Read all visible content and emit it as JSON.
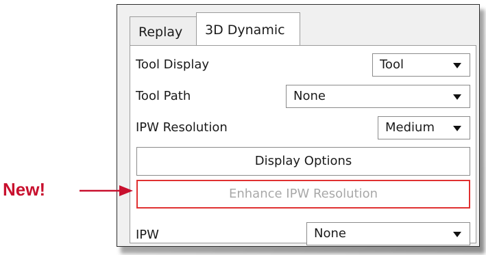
{
  "tabs": [
    {
      "label": "Replay",
      "active": false
    },
    {
      "label": "3D Dynamic",
      "active": true
    }
  ],
  "rows": {
    "tool_display": {
      "label": "Tool Display",
      "value": "Tool"
    },
    "tool_path": {
      "label": "Tool Path",
      "value": "None"
    },
    "ipw_resolution": {
      "label": "IPW Resolution",
      "value": "Medium"
    },
    "ipw": {
      "label": "IPW",
      "value": "None"
    }
  },
  "buttons": {
    "display_options": "Display Options",
    "enhance_ipw": "Enhance IPW Resolution"
  },
  "callout": {
    "text": "New!",
    "color": "#c8102e"
  },
  "colors": {
    "highlight_border": "#e03030",
    "disabled_text": "#a8a8a8"
  }
}
